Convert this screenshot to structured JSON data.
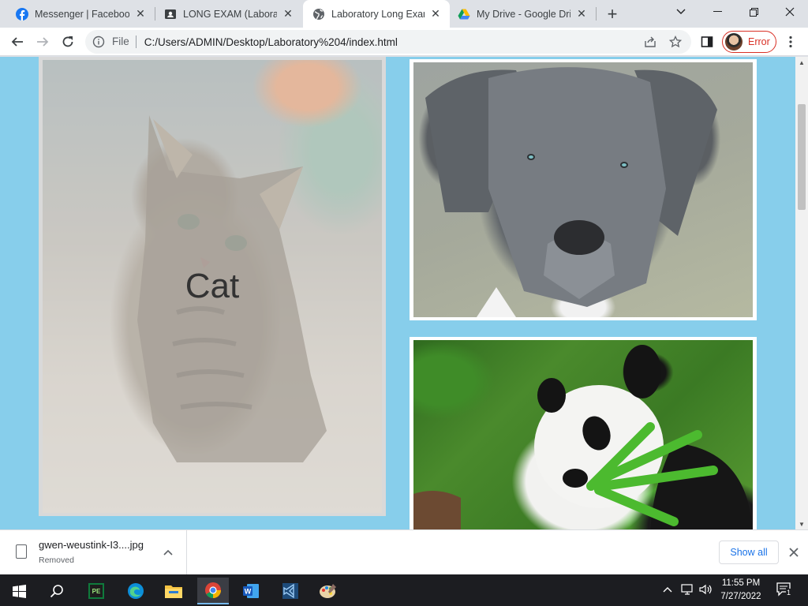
{
  "browser": {
    "tabs": [
      {
        "title": "Messenger | Facebook",
        "icon": "facebook-icon",
        "active": false
      },
      {
        "title": "LONG EXAM (Laborator",
        "icon": "contact-card-icon",
        "active": false
      },
      {
        "title": "Laboratory Long Exam",
        "icon": "globe-icon",
        "active": true
      },
      {
        "title": "My Drive - Google Driv",
        "icon": "google-drive-icon",
        "active": false
      }
    ],
    "omnibox": {
      "scheme_label": "File",
      "url": "C:/Users/ADMIN/Desktop/Laboratory%204/index.html"
    },
    "profile": {
      "label": "Error",
      "status_color": "#d93025"
    }
  },
  "page": {
    "background_color": "#87ceeb",
    "cards": [
      {
        "name": "cat",
        "caption": "Cat"
      },
      {
        "name": "dog",
        "caption": ""
      },
      {
        "name": "panda",
        "caption": ""
      }
    ]
  },
  "download_bar": {
    "file_name": "gwen-weustink-I3....jpg",
    "status": "Removed",
    "show_all_label": "Show all"
  },
  "taskbar": {
    "time": "11:55 PM",
    "date": "7/27/2022",
    "notification_count": "1",
    "apps": [
      "start-icon",
      "search-icon",
      "pe-app-icon",
      "edge-icon",
      "file-explorer-icon",
      "chrome-icon",
      "word-icon",
      "vscode-icon",
      "paint-icon"
    ]
  }
}
